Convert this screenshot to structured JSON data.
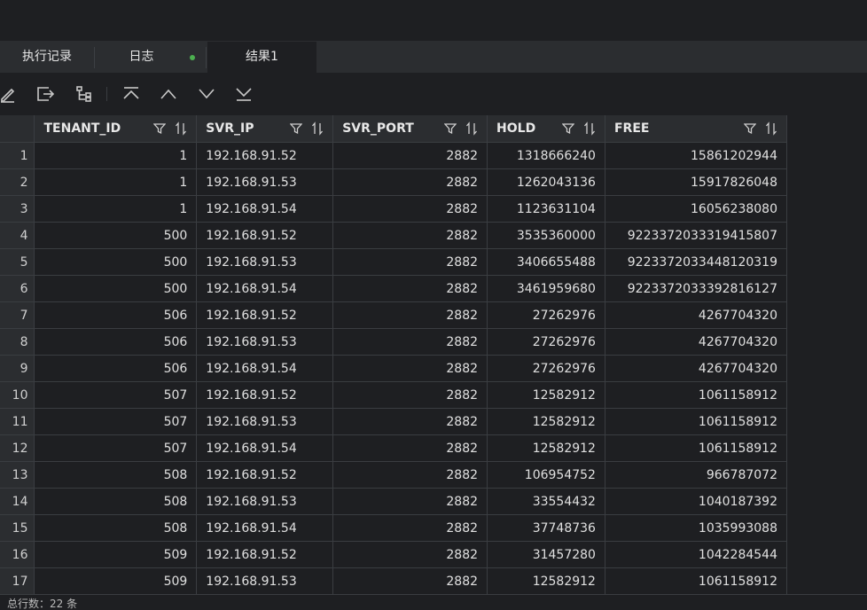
{
  "tabs": [
    {
      "label": "执行记录"
    },
    {
      "label": "日志"
    },
    {
      "label": "结果1"
    }
  ],
  "toolbar": {
    "icons": [
      "edit-icon",
      "export-icon",
      "tree-icon",
      "first-icon",
      "previous-icon",
      "next-icon",
      "last-icon"
    ]
  },
  "colors": {
    "accent_dot": "#4caf50",
    "header_bg": "#2b2d30",
    "background": "#1e1f22"
  },
  "table": {
    "columns": [
      "TENANT_ID",
      "SVR_IP",
      "SVR_PORT",
      "HOLD",
      "FREE"
    ],
    "rows": [
      {
        "n": "1",
        "tenant": "1",
        "ip": "192.168.91.52",
        "port": "2882",
        "hold": "1318666240",
        "free": "15861202944"
      },
      {
        "n": "2",
        "tenant": "1",
        "ip": "192.168.91.53",
        "port": "2882",
        "hold": "1262043136",
        "free": "15917826048"
      },
      {
        "n": "3",
        "tenant": "1",
        "ip": "192.168.91.54",
        "port": "2882",
        "hold": "1123631104",
        "free": "16056238080"
      },
      {
        "n": "4",
        "tenant": "500",
        "ip": "192.168.91.52",
        "port": "2882",
        "hold": "3535360000",
        "free": "9223372033319415807"
      },
      {
        "n": "5",
        "tenant": "500",
        "ip": "192.168.91.53",
        "port": "2882",
        "hold": "3406655488",
        "free": "9223372033448120319"
      },
      {
        "n": "6",
        "tenant": "500",
        "ip": "192.168.91.54",
        "port": "2882",
        "hold": "3461959680",
        "free": "9223372033392816127"
      },
      {
        "n": "7",
        "tenant": "506",
        "ip": "192.168.91.52",
        "port": "2882",
        "hold": "27262976",
        "free": "4267704320"
      },
      {
        "n": "8",
        "tenant": "506",
        "ip": "192.168.91.53",
        "port": "2882",
        "hold": "27262976",
        "free": "4267704320"
      },
      {
        "n": "9",
        "tenant": "506",
        "ip": "192.168.91.54",
        "port": "2882",
        "hold": "27262976",
        "free": "4267704320"
      },
      {
        "n": "10",
        "tenant": "507",
        "ip": "192.168.91.52",
        "port": "2882",
        "hold": "12582912",
        "free": "1061158912"
      },
      {
        "n": "11",
        "tenant": "507",
        "ip": "192.168.91.53",
        "port": "2882",
        "hold": "12582912",
        "free": "1061158912"
      },
      {
        "n": "12",
        "tenant": "507",
        "ip": "192.168.91.54",
        "port": "2882",
        "hold": "12582912",
        "free": "1061158912"
      },
      {
        "n": "13",
        "tenant": "508",
        "ip": "192.168.91.52",
        "port": "2882",
        "hold": "106954752",
        "free": "966787072"
      },
      {
        "n": "14",
        "tenant": "508",
        "ip": "192.168.91.53",
        "port": "2882",
        "hold": "33554432",
        "free": "1040187392"
      },
      {
        "n": "15",
        "tenant": "508",
        "ip": "192.168.91.54",
        "port": "2882",
        "hold": "37748736",
        "free": "1035993088"
      },
      {
        "n": "16",
        "tenant": "509",
        "ip": "192.168.91.52",
        "port": "2882",
        "hold": "31457280",
        "free": "1042284544"
      },
      {
        "n": "17",
        "tenant": "509",
        "ip": "192.168.91.53",
        "port": "2882",
        "hold": "12582912",
        "free": "1061158912"
      }
    ]
  },
  "status": {
    "text": "总行数：22 条"
  }
}
